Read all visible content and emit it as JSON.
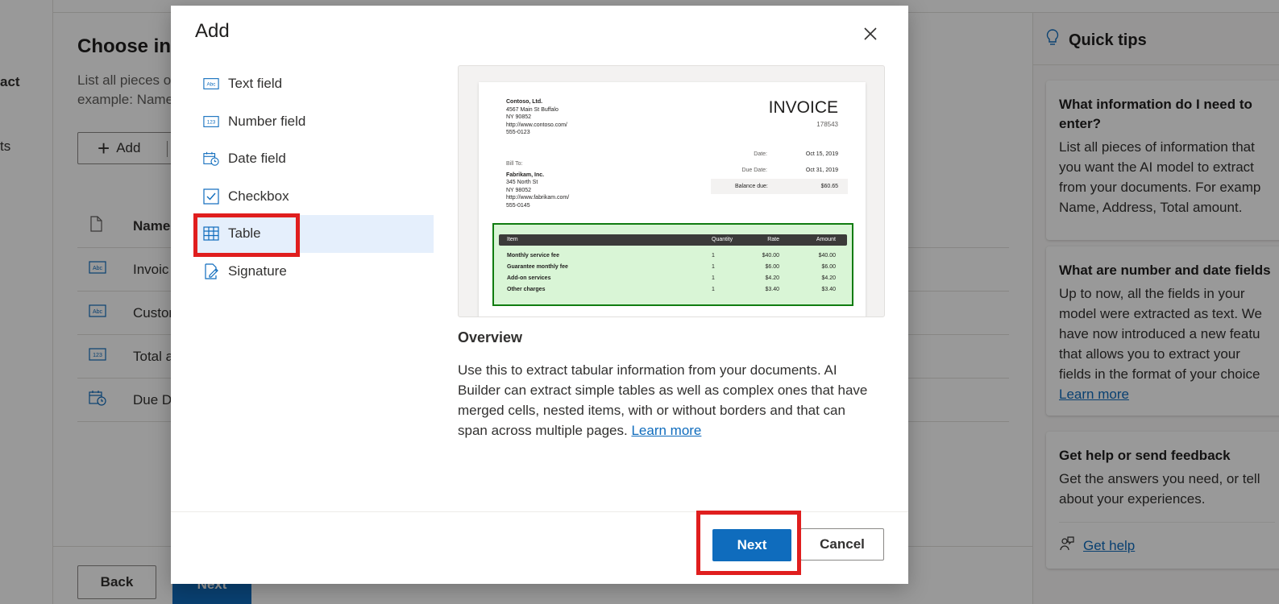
{
  "background": {
    "rail_items": [
      "act",
      "ts"
    ],
    "page_title": "Choose inf",
    "page_desc_line1": "List all pieces o",
    "page_desc_line2": "example: Name",
    "add_label": "Add",
    "table_header": "Name",
    "rows": [
      {
        "icon": "text-field-icon",
        "name": "Invoic"
      },
      {
        "icon": "text-field-icon",
        "name": "Custor"
      },
      {
        "icon": "number-field-icon",
        "name": "Total a"
      },
      {
        "icon": "date-field-icon",
        "name": "Due D"
      }
    ],
    "back_label": "Back",
    "next_label": "Next"
  },
  "quick_tips": {
    "title": "Quick tips",
    "cards": [
      {
        "title_lines": [
          "What information do I need to",
          "enter?"
        ],
        "body_lines": [
          "List all pieces of information that",
          "you want the AI model to extract",
          "from your documents. For examp",
          "Name, Address, Total amount."
        ]
      },
      {
        "title_lines": [
          "What are number and date fields"
        ],
        "body_lines": [
          "Up to now, all the fields in your",
          "model were extracted as text. We",
          "have now introduced a new featu",
          "that allows you to extract your",
          "fields in the format of your choice"
        ],
        "link": "Learn more"
      },
      {
        "title_lines": [
          "Get help or send feedback"
        ],
        "body_lines": [
          "Get the answers you need, or tell",
          "about your experiences."
        ],
        "link": "Get help"
      }
    ]
  },
  "dialog": {
    "title": "Add",
    "field_types": [
      {
        "label": "Text field",
        "icon": "text-field-icon"
      },
      {
        "label": "Number field",
        "icon": "number-field-icon"
      },
      {
        "label": "Date field",
        "icon": "date-field-icon"
      },
      {
        "label": "Checkbox",
        "icon": "checkbox-icon"
      },
      {
        "label": "Table",
        "icon": "table-icon",
        "selected": true
      },
      {
        "label": "Signature",
        "icon": "signature-icon"
      }
    ],
    "preview_invoice": {
      "company_lines": [
        "Contoso, Ltd.",
        "4567 Main St Buffalo",
        "NY 90852",
        "http://www.contoso.com/",
        "555-0123"
      ],
      "title": "INVOICE",
      "number": "178543",
      "bill_to_label": "Bill To:",
      "bill_to_lines": [
        "Fabrikam, Inc.",
        "345 North St",
        "NY 98052",
        "http://www.fabrikam.com/",
        "555-0145"
      ],
      "date_label": "Date:",
      "date_value": "Oct 15, 2019",
      "due_label": "Due Date:",
      "due_value": "Oct 31, 2019",
      "balance_label": "Balance due:",
      "balance_value": "$60.65",
      "columns": [
        "Item",
        "Quantity",
        "Rate",
        "Amount"
      ],
      "rows": [
        [
          "Monthly service fee",
          "1",
          "$40.00",
          "$40.00"
        ],
        [
          "Guarantee monthly fee",
          "1",
          "$6.00",
          "$6.00"
        ],
        [
          "Add-on services",
          "1",
          "$4.20",
          "$4.20"
        ],
        [
          "Other charges",
          "1",
          "$3.40",
          "$3.40"
        ]
      ]
    },
    "overview_title": "Overview",
    "overview_text": "Use this to extract tabular information from your documents. AI Builder can extract simple tables as well as complex ones that have merged cells, nested items, with or without borders and that can span across multiple pages.",
    "overview_link": "Learn more",
    "next_label": "Next",
    "cancel_label": "Cancel"
  },
  "colors": {
    "accent": "#0f6cbd",
    "selected_bg": "#e5effc",
    "highlight": "#e01e1e",
    "table_highlight": "#107c10"
  }
}
